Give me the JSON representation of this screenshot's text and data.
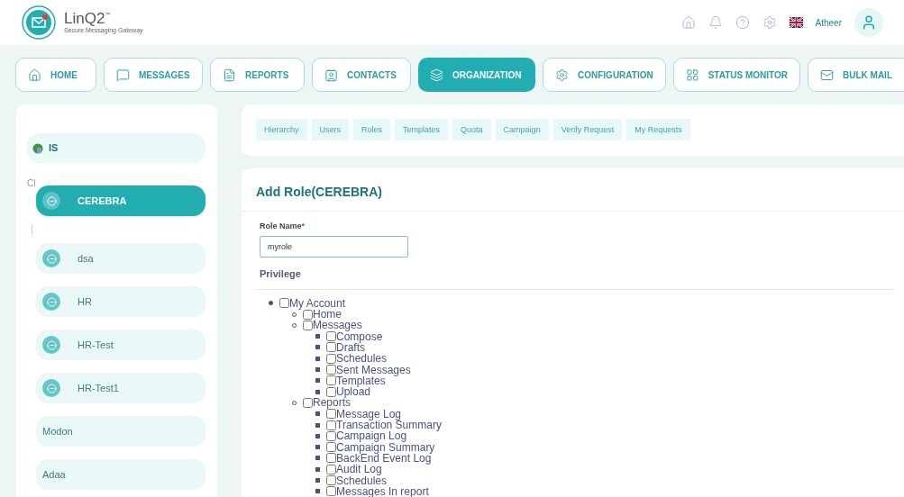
{
  "header": {
    "logo_name": "LinQ2",
    "logo_tm": "™",
    "logo_tagline": "Secure Messaging Gateway",
    "user_name": "Atheer"
  },
  "nav": [
    {
      "label": "HOME",
      "selected": false
    },
    {
      "label": "MESSAGES",
      "selected": false
    },
    {
      "label": "REPORTS",
      "selected": false
    },
    {
      "label": "CONTACTS",
      "selected": false
    },
    {
      "label": "ORGANIZATION",
      "selected": true
    },
    {
      "label": "CONFIGURATION",
      "selected": false
    },
    {
      "label": "STATUS MONITOR",
      "selected": false
    },
    {
      "label": "BULK MAIL",
      "selected": false
    }
  ],
  "sidebar": {
    "root": {
      "label": "IS"
    },
    "section_label": "Cl",
    "items": [
      {
        "label": "CEREBRA",
        "kind": "unit",
        "selected": true
      },
      {
        "label": "dsa",
        "kind": "unit",
        "selected": false
      },
      {
        "label": "HR",
        "kind": "unit",
        "selected": false
      },
      {
        "label": "HR-Test",
        "kind": "unit",
        "selected": false
      },
      {
        "label": "HR-Test1",
        "kind": "unit",
        "selected": false
      },
      {
        "label": "Modon",
        "kind": "plain",
        "selected": false
      },
      {
        "label": "Adaa",
        "kind": "plain",
        "selected": false
      }
    ]
  },
  "subtabs": [
    "Hierarchy",
    "Users",
    "Roles",
    "Templates",
    "Quota",
    "Campaign",
    "Verify Request",
    "My Requests"
  ],
  "form": {
    "title": "Add Role(CEREBRA)",
    "role_name_label": "Role Name",
    "required_mark": "*",
    "role_name_value": "myrole",
    "privilege_heading": "Privilege",
    "privileges": [
      {
        "label": "My Account",
        "checked": false,
        "children": [
          {
            "label": "Home",
            "checked": false
          },
          {
            "label": "Messages",
            "checked": false,
            "children": [
              {
                "label": "Compose",
                "checked": false
              },
              {
                "label": "Drafts",
                "checked": false
              },
              {
                "label": "Schedules",
                "checked": false
              },
              {
                "label": "Sent Messages",
                "checked": false
              },
              {
                "label": "Templates",
                "checked": false
              },
              {
                "label": "Upload",
                "checked": false
              }
            ]
          },
          {
            "label": "Reports",
            "checked": false,
            "children": [
              {
                "label": "Message Log",
                "checked": false
              },
              {
                "label": "Transaction Summary",
                "checked": false
              },
              {
                "label": "Campaign Log",
                "checked": false
              },
              {
                "label": "Campaign Summary",
                "checked": false
              },
              {
                "label": "BackEnd Event Log",
                "checked": false
              },
              {
                "label": "Audit Log",
                "checked": false
              },
              {
                "label": "Schedules",
                "checked": false
              },
              {
                "label": "Messages In report",
                "checked": false
              }
            ]
          }
        ]
      }
    ]
  }
}
